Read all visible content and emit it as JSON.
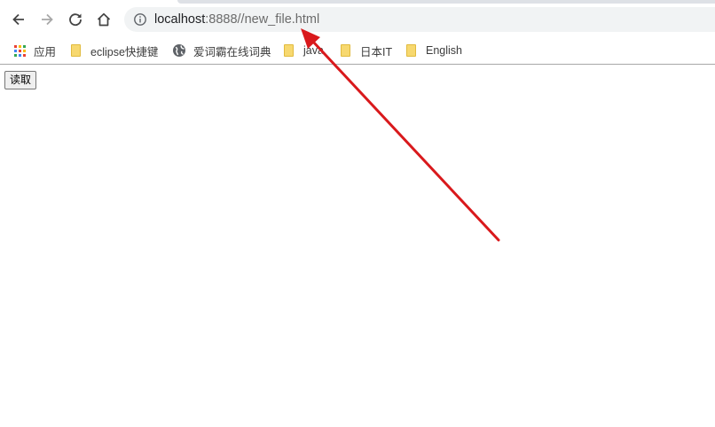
{
  "browser": {
    "url_host": "localhost",
    "url_rest": ":8888//new_file.html",
    "nav_icons": [
      "back-arrow-icon",
      "forward-arrow-icon",
      "reload-icon",
      "home-icon",
      "info-icon"
    ]
  },
  "bookmarks": {
    "items": [
      {
        "label": "应用",
        "icon": "apps-icon"
      },
      {
        "label": "eclipse快捷键",
        "icon": "folder-icon"
      },
      {
        "label": "爱词霸在线词典",
        "icon": "globe-icon"
      },
      {
        "label": "java",
        "icon": "folder-icon"
      },
      {
        "label": "日本IT",
        "icon": "folder-icon"
      },
      {
        "label": "English",
        "icon": "folder-icon"
      }
    ]
  },
  "page": {
    "read_button_label": "读取"
  },
  "colors": {
    "annotation_arrow": "#d9191c",
    "omnibox_bg": "#f1f3f4",
    "folder_fill": "#f7d86f"
  }
}
